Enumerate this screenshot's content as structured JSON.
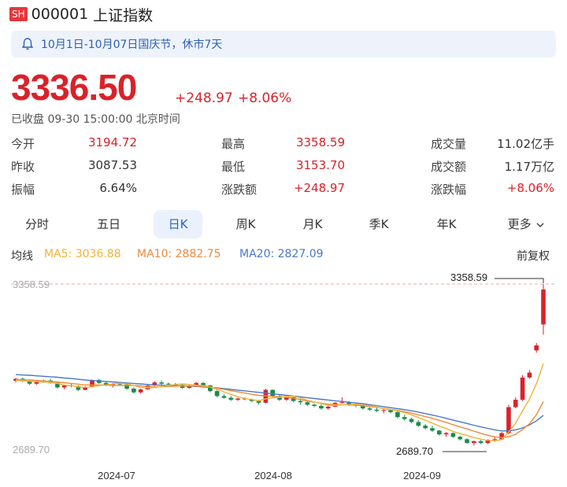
{
  "header": {
    "exchange_badge": "SH",
    "code": "000001",
    "name": "上证指数"
  },
  "notice": {
    "text": "10月1日-10月07日国庆节，休市7天",
    "icon": "bell-icon"
  },
  "quote": {
    "price": "3336.50",
    "change_abs": "+248.97",
    "change_pct": "+8.06%",
    "status": "已收盘 09-30 15:00:00 北京时间"
  },
  "stats": [
    [
      {
        "label": "今开",
        "value": "3194.72"
      },
      {
        "label": "最高",
        "value": "3358.59"
      },
      {
        "label": "成交量",
        "value": "11.02亿手"
      }
    ],
    [
      {
        "label": "昨收",
        "value": "3087.53"
      },
      {
        "label": "最低",
        "value": "3153.70"
      },
      {
        "label": "成交额",
        "value": "1.17万亿"
      }
    ],
    [
      {
        "label": "振幅",
        "value": "6.64%"
      },
      {
        "label": "涨跌额",
        "value": "+248.97"
      },
      {
        "label": "涨跌幅",
        "value": "+8.06%"
      }
    ]
  ],
  "tabs": [
    "分时",
    "五日",
    "日K",
    "周K",
    "月K",
    "季K",
    "年K",
    "更多"
  ],
  "active_tab": "日K",
  "indicators": {
    "label": "均线",
    "ma5": "MA5: 3036.88",
    "ma10": "MA10: 2882.75",
    "ma20": "MA20: 2827.09",
    "adjust": "前复权"
  },
  "colors": {
    "up": "#d9222a",
    "down": "#1a8a4a",
    "ma5": "#f0b23a",
    "ma10": "#ee8a3c",
    "ma20": "#4a78c8",
    "accent": "#2b62c8"
  },
  "chart_data": {
    "type": "candlestick",
    "y_labels": {
      "top": "3358.59",
      "bottom": "2689.70"
    },
    "annotations": {
      "high": "3358.59",
      "low": "2689.70"
    },
    "x_ticks": [
      "2024-07",
      "2024-08",
      "2024-09"
    ],
    "ylim": [
      2689.7,
      3358.59
    ],
    "candles": [
      [
        2967,
        2978,
        2960,
        2975
      ],
      [
        2975,
        2980,
        2962,
        2965
      ],
      [
        2965,
        2972,
        2950,
        2955
      ],
      [
        2955,
        2968,
        2950,
        2965
      ],
      [
        2965,
        2972,
        2958,
        2968
      ],
      [
        2968,
        2975,
        2955,
        2958
      ],
      [
        2958,
        2962,
        2935,
        2940
      ],
      [
        2940,
        2950,
        2932,
        2948
      ],
      [
        2948,
        2955,
        2940,
        2945
      ],
      [
        2945,
        2948,
        2925,
        2930
      ],
      [
        2930,
        2945,
        2928,
        2942
      ],
      [
        2942,
        2972,
        2940,
        2970
      ],
      [
        2970,
        2975,
        2955,
        2958
      ],
      [
        2958,
        2962,
        2945,
        2950
      ],
      [
        2950,
        2958,
        2940,
        2955
      ],
      [
        2955,
        2962,
        2948,
        2952
      ],
      [
        2952,
        2956,
        2930,
        2935
      ],
      [
        2935,
        2940,
        2915,
        2920
      ],
      [
        2920,
        2935,
        2915,
        2932
      ],
      [
        2932,
        2950,
        2930,
        2948
      ],
      [
        2948,
        2965,
        2945,
        2960
      ],
      [
        2960,
        2968,
        2950,
        2955
      ],
      [
        2955,
        2960,
        2945,
        2952
      ],
      [
        2952,
        2958,
        2945,
        2950
      ],
      [
        2950,
        2955,
        2935,
        2938
      ],
      [
        2938,
        2950,
        2935,
        2945
      ],
      [
        2945,
        2962,
        2943,
        2958
      ],
      [
        2958,
        2962,
        2945,
        2948
      ],
      [
        2948,
        2950,
        2920,
        2925
      ],
      [
        2925,
        2930,
        2900,
        2905
      ],
      [
        2905,
        2912,
        2895,
        2898
      ],
      [
        2898,
        2905,
        2885,
        2890
      ],
      [
        2890,
        2898,
        2885,
        2895
      ],
      [
        2895,
        2900,
        2888,
        2892
      ],
      [
        2892,
        2895,
        2880,
        2885
      ],
      [
        2885,
        2890,
        2870,
        2878
      ],
      [
        2878,
        2935,
        2875,
        2930
      ],
      [
        2930,
        2932,
        2900,
        2905
      ],
      [
        2905,
        2910,
        2885,
        2890
      ],
      [
        2890,
        2905,
        2885,
        2900
      ],
      [
        2900,
        2905,
        2880,
        2885
      ],
      [
        2885,
        2895,
        2870,
        2880
      ],
      [
        2880,
        2888,
        2865,
        2870
      ],
      [
        2870,
        2875,
        2860,
        2865
      ],
      [
        2865,
        2872,
        2850,
        2855
      ],
      [
        2855,
        2865,
        2850,
        2862
      ],
      [
        2862,
        2880,
        2860,
        2878
      ],
      [
        2878,
        2900,
        2875,
        2880
      ],
      [
        2880,
        2885,
        2865,
        2870
      ],
      [
        2870,
        2878,
        2860,
        2866
      ],
      [
        2866,
        2872,
        2850,
        2855
      ],
      [
        2855,
        2860,
        2845,
        2850
      ],
      [
        2850,
        2860,
        2840,
        2845
      ],
      [
        2845,
        2852,
        2835,
        2848
      ],
      [
        2848,
        2850,
        2835,
        2840
      ],
      [
        2840,
        2845,
        2815,
        2820
      ],
      [
        2820,
        2830,
        2805,
        2812
      ],
      [
        2812,
        2818,
        2795,
        2800
      ],
      [
        2800,
        2808,
        2780,
        2785
      ],
      [
        2785,
        2792,
        2770,
        2775
      ],
      [
        2775,
        2785,
        2760,
        2765
      ],
      [
        2765,
        2768,
        2745,
        2750
      ],
      [
        2750,
        2760,
        2740,
        2755
      ],
      [
        2755,
        2758,
        2735,
        2740
      ],
      [
        2740,
        2745,
        2725,
        2730
      ],
      [
        2730,
        2735,
        2712,
        2715
      ],
      [
        2715,
        2725,
        2705,
        2722
      ],
      [
        2722,
        2728,
        2710,
        2715
      ],
      [
        2715,
        2730,
        2710,
        2728
      ],
      [
        2728,
        2740,
        2720,
        2730
      ],
      [
        2730,
        2760,
        2726,
        2755
      ],
      [
        2755,
        2870,
        2750,
        2860
      ],
      [
        2860,
        2900,
        2855,
        2890
      ],
      [
        2890,
        2990,
        2885,
        2980
      ],
      [
        2980,
        3010,
        2975,
        3000
      ],
      [
        3090,
        3120,
        3080,
        3110
      ],
      [
        3195,
        3358.59,
        3153.7,
        3336.5
      ]
    ],
    "ma5": [
      2968,
      2967,
      2965,
      2963,
      2962,
      2960,
      2956,
      2950,
      2947,
      2942,
      2940,
      2943,
      2947,
      2950,
      2954,
      2957,
      2954,
      2948,
      2940,
      2938,
      2940,
      2944,
      2948,
      2952,
      2954,
      2952,
      2949,
      2948,
      2942,
      2932,
      2922,
      2912,
      2902,
      2895,
      2891,
      2886,
      2894,
      2898,
      2900,
      2903,
      2904,
      2898,
      2888,
      2881,
      2874,
      2868,
      2867,
      2869,
      2871,
      2872,
      2870,
      2866,
      2860,
      2854,
      2850,
      2845,
      2838,
      2829,
      2818,
      2807,
      2795,
      2784,
      2773,
      2762,
      2753,
      2745,
      2737,
      2731,
      2725,
      2724,
      2729,
      2759,
      2795,
      2845,
      2893,
      2955,
      3036.88
    ],
    "ma10": [
      2972,
      2971,
      2970,
      2968,
      2966,
      2964,
      2962,
      2959,
      2956,
      2953,
      2950,
      2950,
      2950,
      2949,
      2948,
      2948,
      2948,
      2948,
      2946,
      2944,
      2942,
      2943,
      2944,
      2945,
      2946,
      2946,
      2945,
      2944,
      2941,
      2937,
      2932,
      2927,
      2922,
      2917,
      2912,
      2908,
      2906,
      2904,
      2902,
      2900,
      2896,
      2891,
      2885,
      2880,
      2876,
      2872,
      2871,
      2870,
      2869,
      2868,
      2866,
      2863,
      2859,
      2855,
      2851,
      2847,
      2842,
      2836,
      2829,
      2822,
      2815,
      2807,
      2798,
      2789,
      2780,
      2772,
      2763,
      2754,
      2746,
      2740,
      2737,
      2740,
      2750,
      2770,
      2793,
      2830,
      2882.75
    ],
    "ma20": [
      2992,
      2990,
      2989,
      2987,
      2985,
      2983,
      2981,
      2978,
      2976,
      2973,
      2970,
      2968,
      2966,
      2964,
      2962,
      2960,
      2958,
      2956,
      2954,
      2952,
      2950,
      2949,
      2948,
      2947,
      2946,
      2945,
      2944,
      2942,
      2940,
      2938,
      2935,
      2932,
      2929,
      2926,
      2923,
      2920,
      2917,
      2914,
      2911,
      2908,
      2905,
      2902,
      2898,
      2895,
      2892,
      2889,
      2886,
      2883,
      2880,
      2877,
      2874,
      2870,
      2866,
      2862,
      2858,
      2854,
      2850,
      2845,
      2840,
      2834,
      2828,
      2822,
      2815,
      2808,
      2801,
      2794,
      2787,
      2780,
      2774,
      2768,
      2764,
      2764,
      2768,
      2776,
      2788,
      2805,
      2827.09
    ]
  }
}
